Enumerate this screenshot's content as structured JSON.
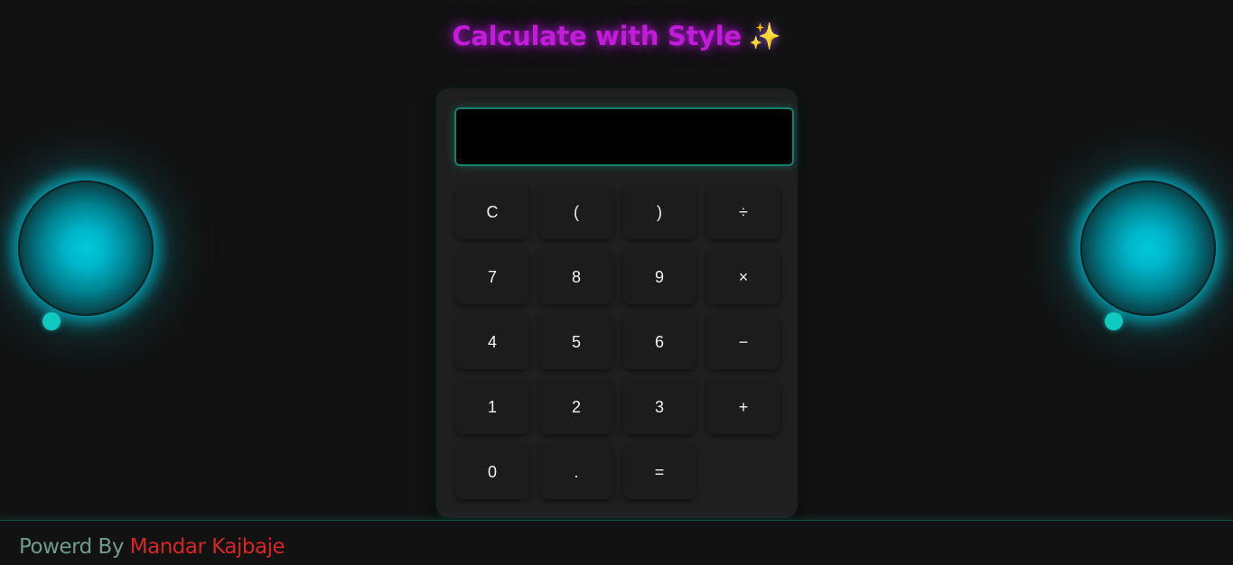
{
  "header": {
    "title": "Calculate with Style",
    "sparkle_icon": "✨",
    "title_color": "#c21bd9"
  },
  "decorations": {
    "orb_color": "#00c8dc",
    "dot_color": "#10c9c0"
  },
  "calculator": {
    "display_value": "",
    "keys": [
      {
        "label": "C",
        "name": "clear-button"
      },
      {
        "label": "(",
        "name": "open-paren-button"
      },
      {
        "label": ")",
        "name": "close-paren-button"
      },
      {
        "label": "÷",
        "name": "divide-button"
      },
      {
        "label": "7",
        "name": "digit-7-button"
      },
      {
        "label": "8",
        "name": "digit-8-button"
      },
      {
        "label": "9",
        "name": "digit-9-button"
      },
      {
        "label": "×",
        "name": "multiply-button"
      },
      {
        "label": "4",
        "name": "digit-4-button"
      },
      {
        "label": "5",
        "name": "digit-5-button"
      },
      {
        "label": "6",
        "name": "digit-6-button"
      },
      {
        "label": "−",
        "name": "subtract-button"
      },
      {
        "label": "1",
        "name": "digit-1-button"
      },
      {
        "label": "2",
        "name": "digit-2-button"
      },
      {
        "label": "3",
        "name": "digit-3-button"
      },
      {
        "label": "+",
        "name": "add-button"
      },
      {
        "label": "0",
        "name": "digit-0-button"
      },
      {
        "label": ".",
        "name": "decimal-button"
      },
      {
        "label": "=",
        "name": "equals-button"
      }
    ],
    "accent_color": "#12806e"
  },
  "footer": {
    "prefix": "Powerd By ",
    "author": "Mandar Kajbaje",
    "prefix_color": "#6f9a90",
    "author_color": "#d62626"
  }
}
